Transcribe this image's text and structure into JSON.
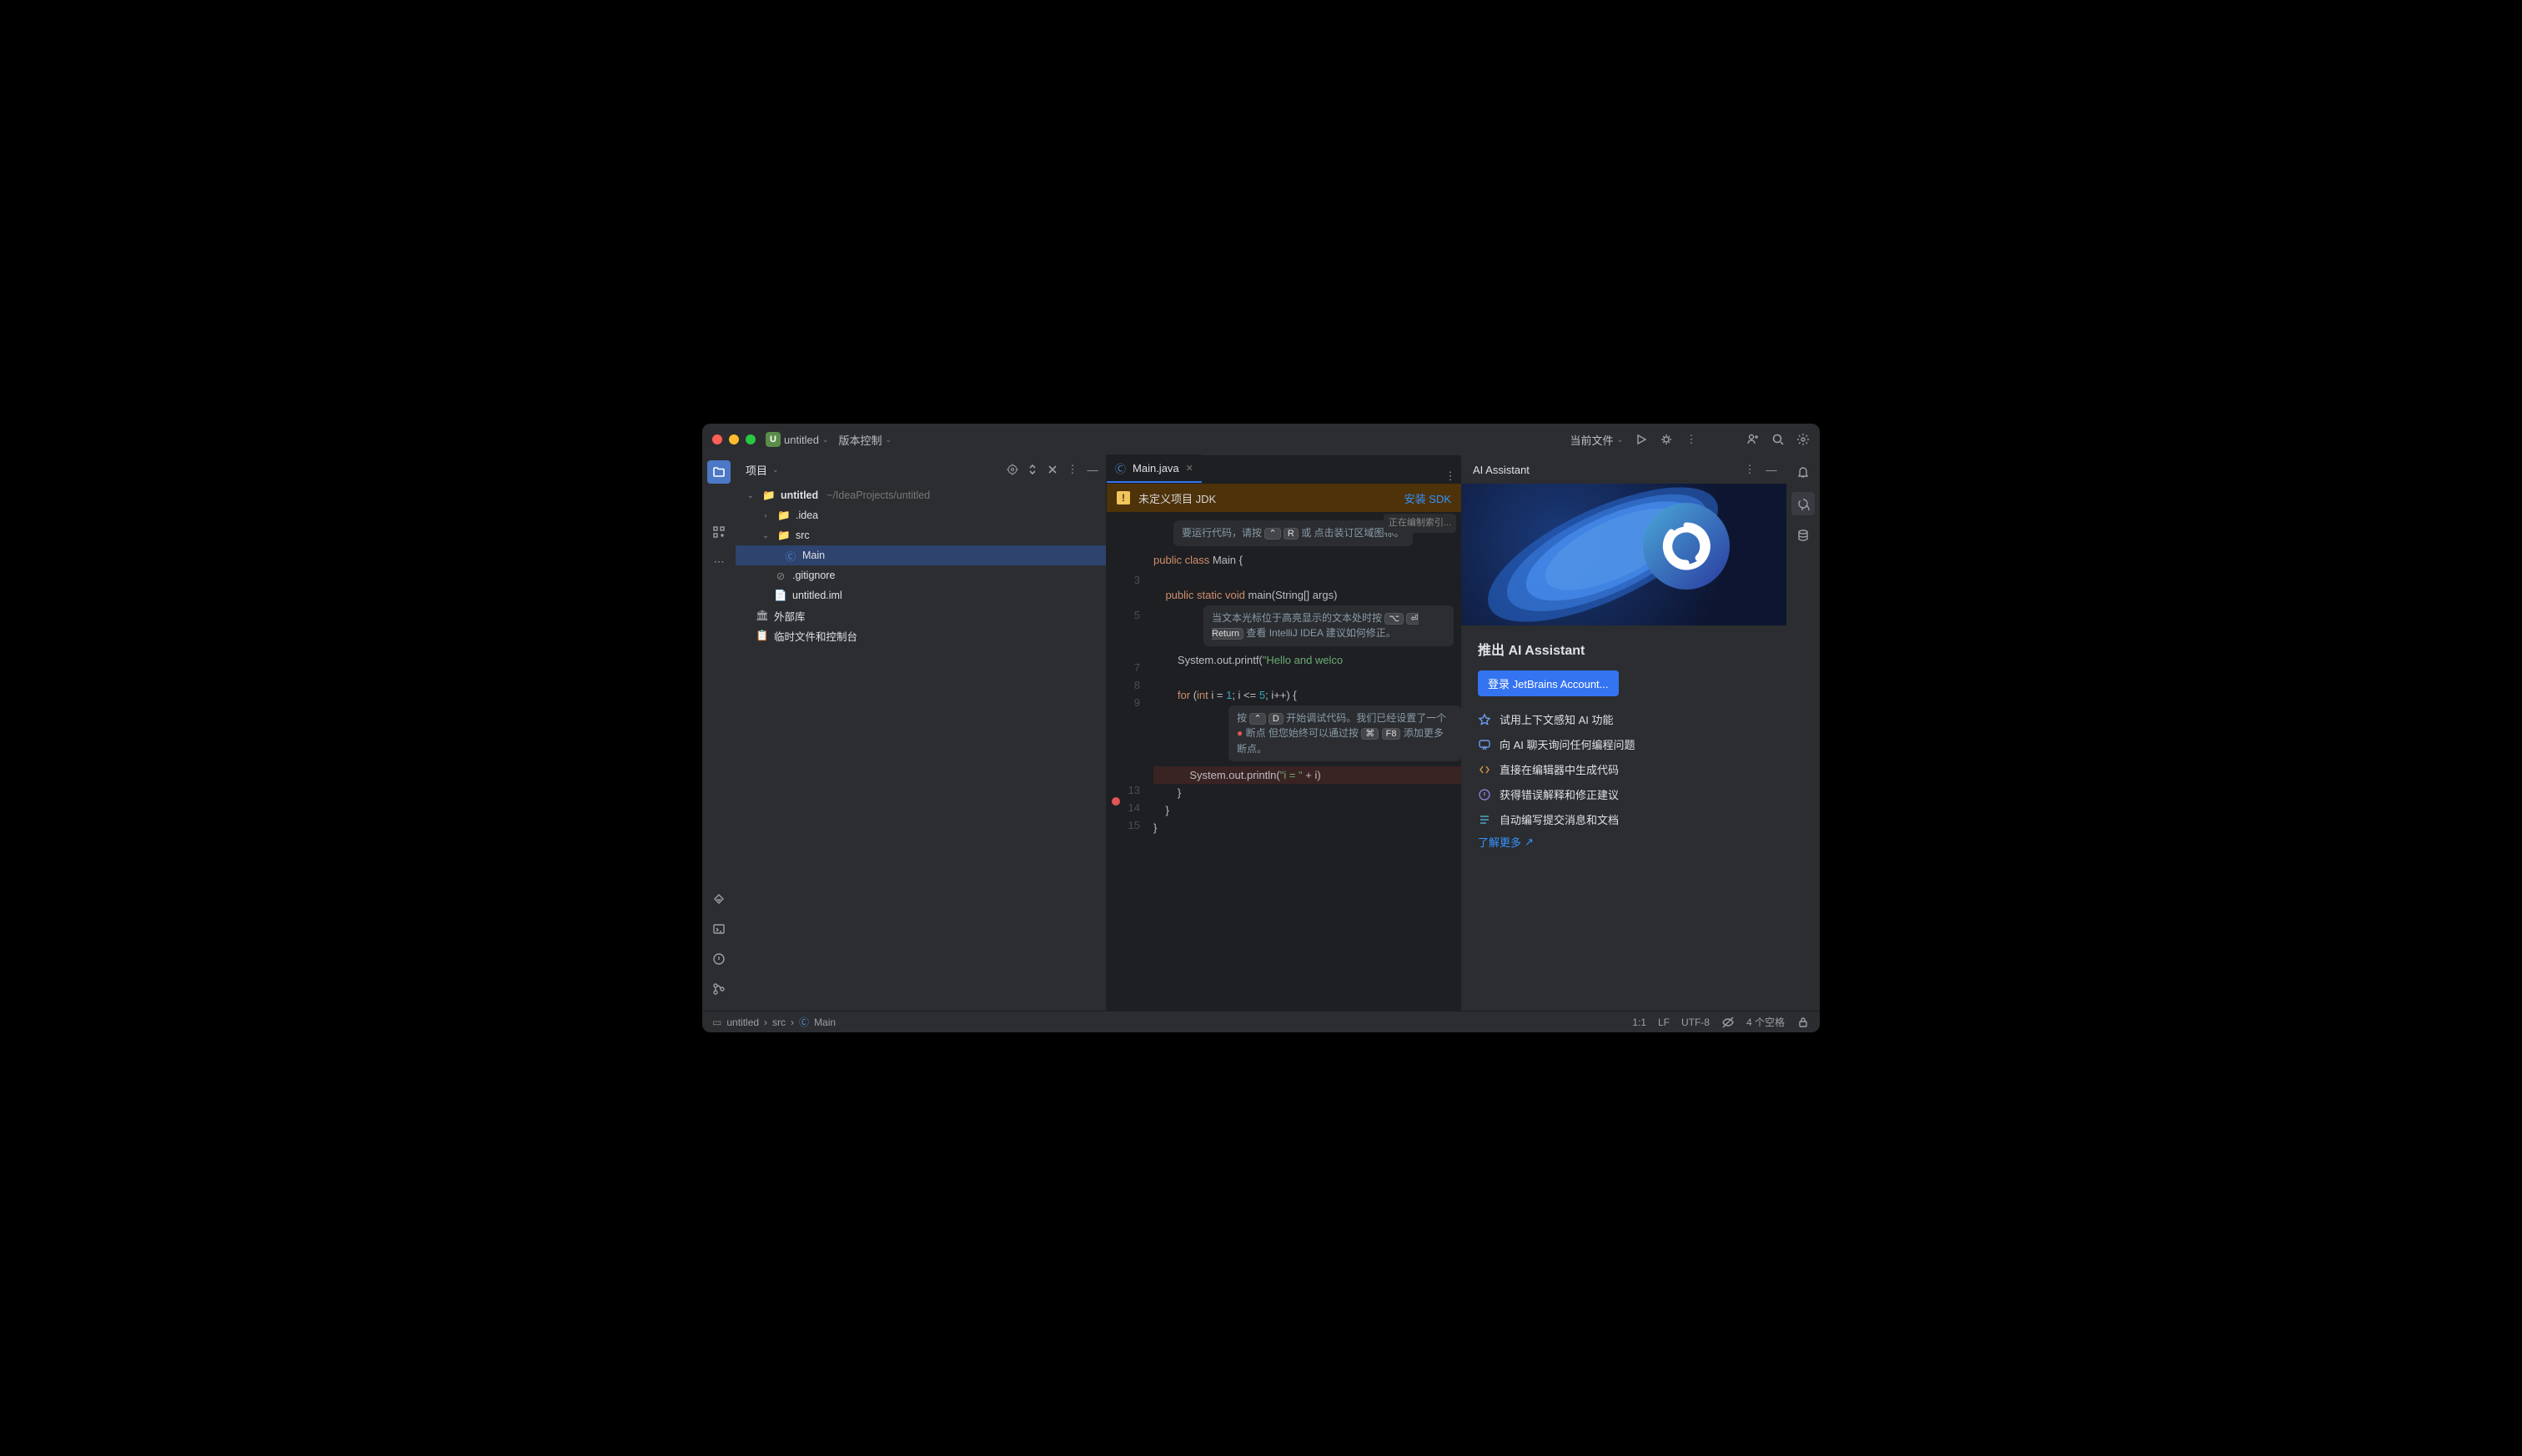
{
  "titlebar": {
    "project_letter": "U",
    "project_name": "untitled",
    "vcs": "版本控制",
    "current_file": "当前文件"
  },
  "project_panel": {
    "title": "项目",
    "root": {
      "name": "untitled",
      "path": "~/IdeaProjects/untitled"
    },
    "idea": ".idea",
    "src": "src",
    "main": "Main",
    "gitignore": ".gitignore",
    "iml": "untitled.iml",
    "external": "外部库",
    "scratches": "临时文件和控制台"
  },
  "editor": {
    "tab": "Main.java",
    "banner_text": "未定义项目 JDK",
    "banner_link": "安装 SDK",
    "indexing": "正在编制索引...",
    "hint1_a": "要运行代码，请按",
    "hint1_b": "或 点击装订区域图标。",
    "hint2_a": "当文本光标位于高亮显示的文本处时按",
    "hint2_b": "查看 IntelliJ IDEA 建议如何修正。",
    "hint3_a": "按",
    "hint3_b": "开始调试代码。我们已经设置了一个",
    "hint3_c": "断点 但您始终可以通过按",
    "hint3_d": "添加更多断点。",
    "key_ctrl": "⌃",
    "key_r": "R",
    "key_opt": "⌥",
    "key_return": "⏎ Return",
    "key_ctrl2": "⌃",
    "key_d": "D",
    "key_cmd": "⌘",
    "key_f8": "F8",
    "ln3": "public class Main {",
    "ln5": "    public static void main(String[] args)",
    "ln7": "        System.out.printf(\"Hello and welco",
    "ln9": "        for (int i = 1; i <= 5; i++) {",
    "ln12": "            System.out.println(\"i = \" + i)",
    "ln13": "        }",
    "ln14": "    }",
    "ln15": "}",
    "gutter": [
      "",
      "",
      "3",
      "",
      "5",
      "",
      "7",
      "8",
      "9",
      "",
      "",
      "",
      "13",
      "14",
      "15"
    ]
  },
  "ai": {
    "header": "AI Assistant",
    "title": "推出 AI Assistant",
    "login": "登录 JetBrains Account...",
    "items": [
      "试用上下文感知 AI 功能",
      "向 AI 聊天询问任何编程问题",
      "直接在编辑器中生成代码",
      "获得错误解释和修正建议",
      "自动编写提交消息和文档"
    ],
    "more": "了解更多"
  },
  "status": {
    "crumbs": [
      "untitled",
      "src",
      "Main"
    ],
    "pos": "1:1",
    "eol": "LF",
    "enc": "UTF-8",
    "indent": "4 个空格"
  }
}
